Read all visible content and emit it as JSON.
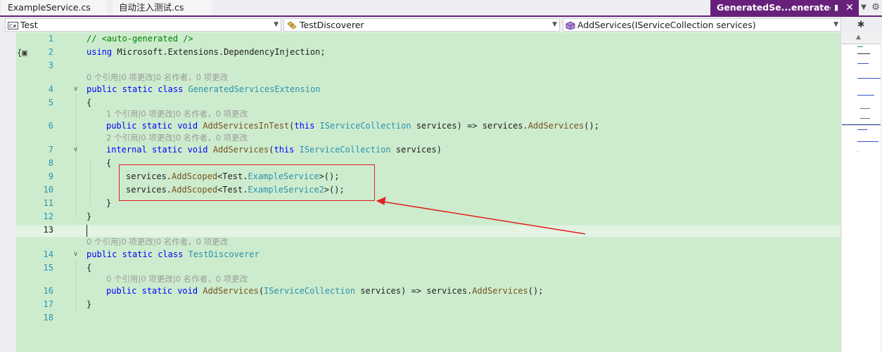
{
  "tabs": [
    {
      "label": "ExampleService.cs"
    },
    {
      "label": "自动注入测试.cs"
    },
    {
      "label": "GeneratedSe...enerated.cs",
      "active": true
    }
  ],
  "tab_controls": {
    "pin_icon": "pin-icon",
    "close_icon": "close-icon",
    "overflow_icon": "chevron-down-icon",
    "settings_icon": "gear-icon"
  },
  "navbar": {
    "project": "Test",
    "type": "TestDiscoverer",
    "member": "AddServices(IServiceCollection services)"
  },
  "editor": {
    "current_line": "13",
    "lines": [
      {
        "n": "1"
      },
      {
        "n": "2"
      },
      {
        "n": "3"
      },
      {
        "n": "4"
      },
      {
        "n": "5"
      },
      {
        "n": "6"
      },
      {
        "n": "7"
      },
      {
        "n": "8"
      },
      {
        "n": "9"
      },
      {
        "n": "10"
      },
      {
        "n": "11"
      },
      {
        "n": "12"
      },
      {
        "n": "13"
      },
      {
        "n": "14"
      },
      {
        "n": "15"
      },
      {
        "n": "16"
      },
      {
        "n": "17"
      },
      {
        "n": "18"
      }
    ],
    "codelens": {
      "l4": "0 个引用|0 项更改|0 名作者，0 项更改",
      "l6": "1 个引用|0 项更改|0 名作者，0 项更改",
      "l7": "2 个引用|0 项更改|0 名作者，0 项更改",
      "l14": "0 个引用|0 项更改|0 名作者，0 项更改",
      "l16": "0 个引用|0 项更改|0 名作者，0 项更改"
    },
    "tokens": {
      "l1_comment": "// <auto-generated />",
      "using": "using",
      "ns": " Microsoft.Extensions.DependencyInjection;",
      "public": "public",
      "static": "static",
      "class": "class",
      "void": "void",
      "internal": "internal",
      "this": "this",
      "class1": "GeneratedServicesExtension",
      "class2": "TestDiscoverer",
      "open_brace": "{",
      "close_brace": "}",
      "m_add_in_test": "AddServicesInTest",
      "m_add_services": "AddServices",
      "iservicecollection": "IServiceCollection",
      "services": "services",
      "add_scoped": "AddScoped",
      "test_ns": "Test.",
      "example_service": "ExampleService",
      "example_service2": "ExampleService2",
      "lambda": "=>",
      "call_end": "();",
      "generic_end1": ">();",
      "generic_end2": ">();"
    }
  },
  "colors": {
    "active_tab": "#68217a",
    "editor_bg": "#cdeccd",
    "keyword": "#0000ff",
    "type": "#2b91af",
    "highlight": "#e02020"
  }
}
